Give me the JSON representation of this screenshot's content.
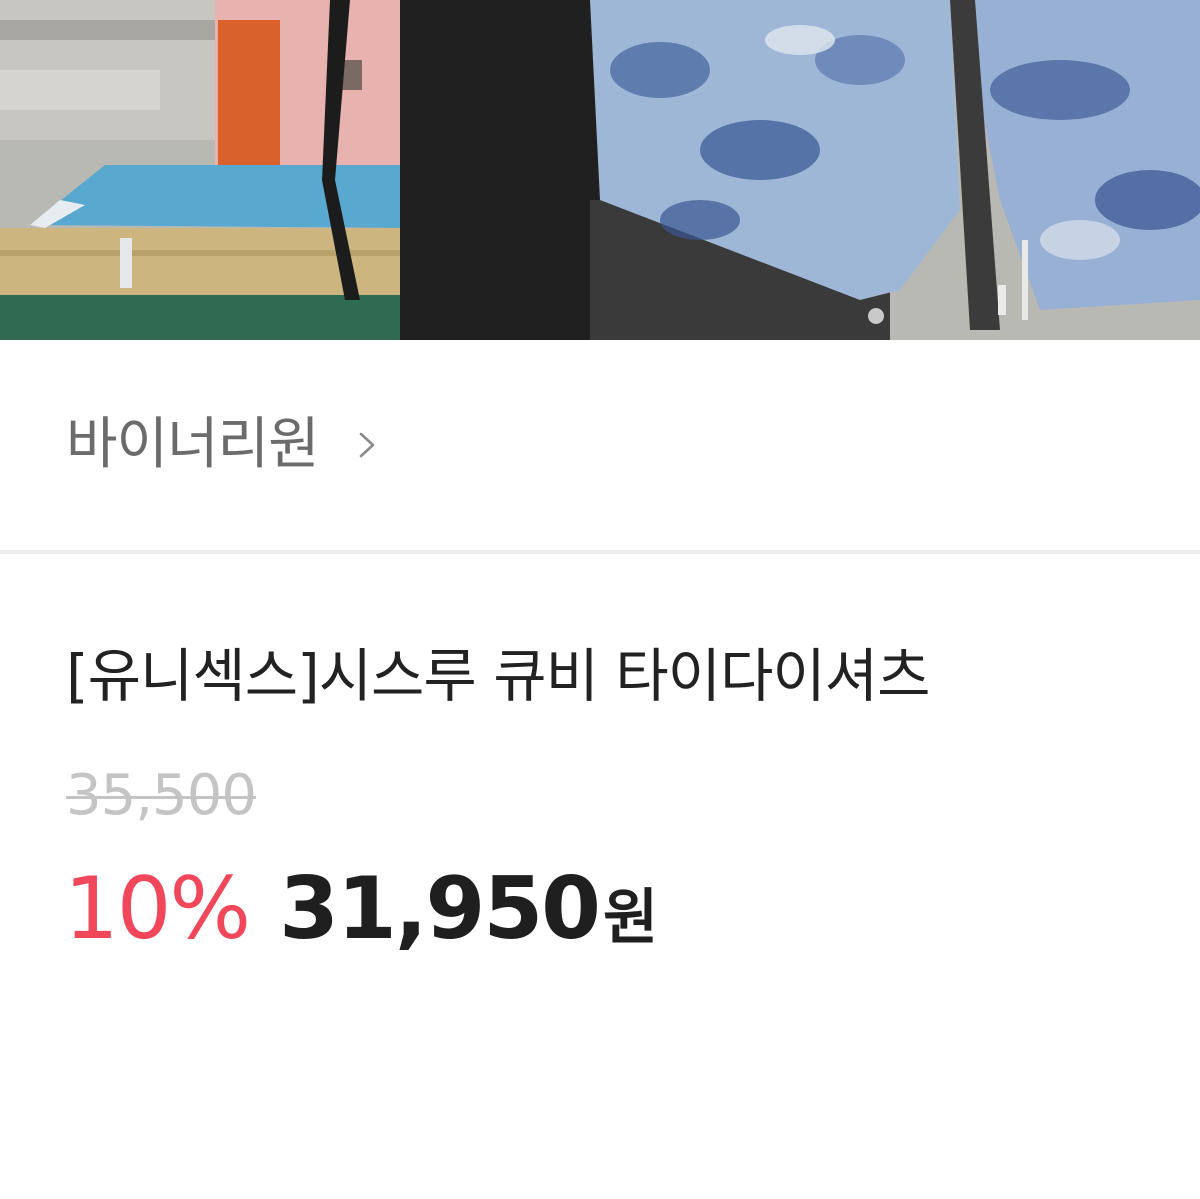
{
  "seller": {
    "name": "바이너리원"
  },
  "product": {
    "title": "[유니섹스]시스루 큐비 타이다이셔츠",
    "original_price": "35,500",
    "discount": "10%",
    "sale_price": "31,950",
    "currency": "원"
  },
  "colors": {
    "discount": "#f0485a",
    "original_price": "#c4c4c4",
    "divider": "#ececec"
  },
  "icons": {
    "seller_chevron": "chevron-right-icon"
  }
}
